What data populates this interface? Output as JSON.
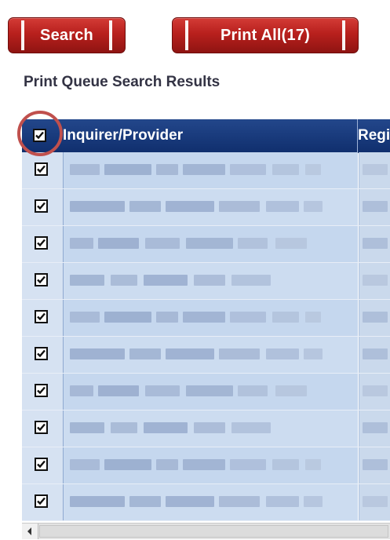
{
  "toolbar": {
    "search_label": "Search",
    "print_all_label": "Print All(17)"
  },
  "section_title": "Print Queue Search Results",
  "table": {
    "columns": [
      "Inquirer/Provider",
      "Regist"
    ],
    "header_checked": true,
    "visible_row_count": 10,
    "rows_checked": [
      true,
      true,
      true,
      true,
      true,
      true,
      true,
      true,
      true,
      true
    ]
  },
  "colors": {
    "button_red": "#b8201d",
    "header_blue": "#1a3c7e",
    "row_blue": "#c5d7ee",
    "highlight_circle": "#c0504d"
  }
}
